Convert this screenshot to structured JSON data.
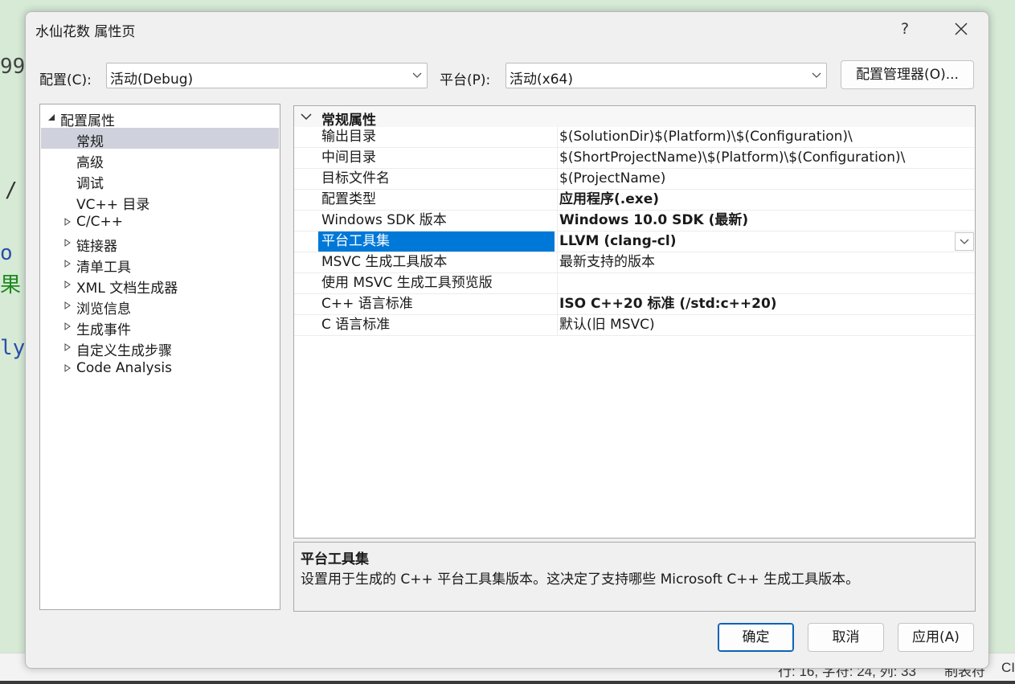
{
  "background": {
    "fragments": [
      "99",
      "/",
      "o *",
      "果",
      "ly"
    ],
    "status_segments": [
      "行: 16, 字符: 24, 列: 33",
      "制表符",
      "CI"
    ]
  },
  "dialog": {
    "title": "水仙花数 属性页",
    "help_label": "?",
    "close_label": "✕",
    "config_label": "配置(C):",
    "config_value": "活动(Debug)",
    "platform_label": "平台(P):",
    "platform_value": "活动(x64)",
    "config_manager_label": "配置管理器(O)..."
  },
  "tree": {
    "root": "配置属性",
    "children_leaf": [
      "常规",
      "高级",
      "调试",
      "VC++ 目录"
    ],
    "children_collapsed": [
      "C/C++",
      "链接器",
      "清单工具",
      "XML 文档生成器",
      "浏览信息",
      "生成事件",
      "自定义生成步骤",
      "Code Analysis"
    ]
  },
  "grid": {
    "section": "常规属性",
    "rows": [
      {
        "name": "输出目录",
        "value": "$(SolutionDir)$(Platform)\\$(Configuration)\\"
      },
      {
        "name": "中间目录",
        "value": "$(ShortProjectName)\\$(Platform)\\$(Configuration)\\"
      },
      {
        "name": "目标文件名",
        "value": "$(ProjectName)"
      },
      {
        "name": "配置类型",
        "value": "应用程序(.exe)"
      },
      {
        "name": "Windows SDK 版本",
        "value": "Windows 10.0 SDK (最新)"
      },
      {
        "name": "平台工具集",
        "value": "LLVM (clang-cl)"
      },
      {
        "name": "MSVC 生成工具版本",
        "value": "最新支持的版本"
      },
      {
        "name": "使用 MSVC 生成工具预览版",
        "value": ""
      },
      {
        "name": "C++ 语言标准",
        "value": "ISO C++20 标准 (/std:c++20)"
      },
      {
        "name": "C 语言标准",
        "value": "默认(旧 MSVC)"
      }
    ]
  },
  "description": {
    "title": "平台工具集",
    "text": "设置用于生成的 C++ 平台工具集版本。这决定了支持哪些 Microsoft C++ 生成工具版本。"
  },
  "buttons": {
    "ok": "确定",
    "cancel": "取消",
    "apply": "应用(A)"
  },
  "colors": {
    "selection": "#0078d7",
    "tree_selection": "#cfd2dc",
    "primary_border": "#0b63b6"
  }
}
